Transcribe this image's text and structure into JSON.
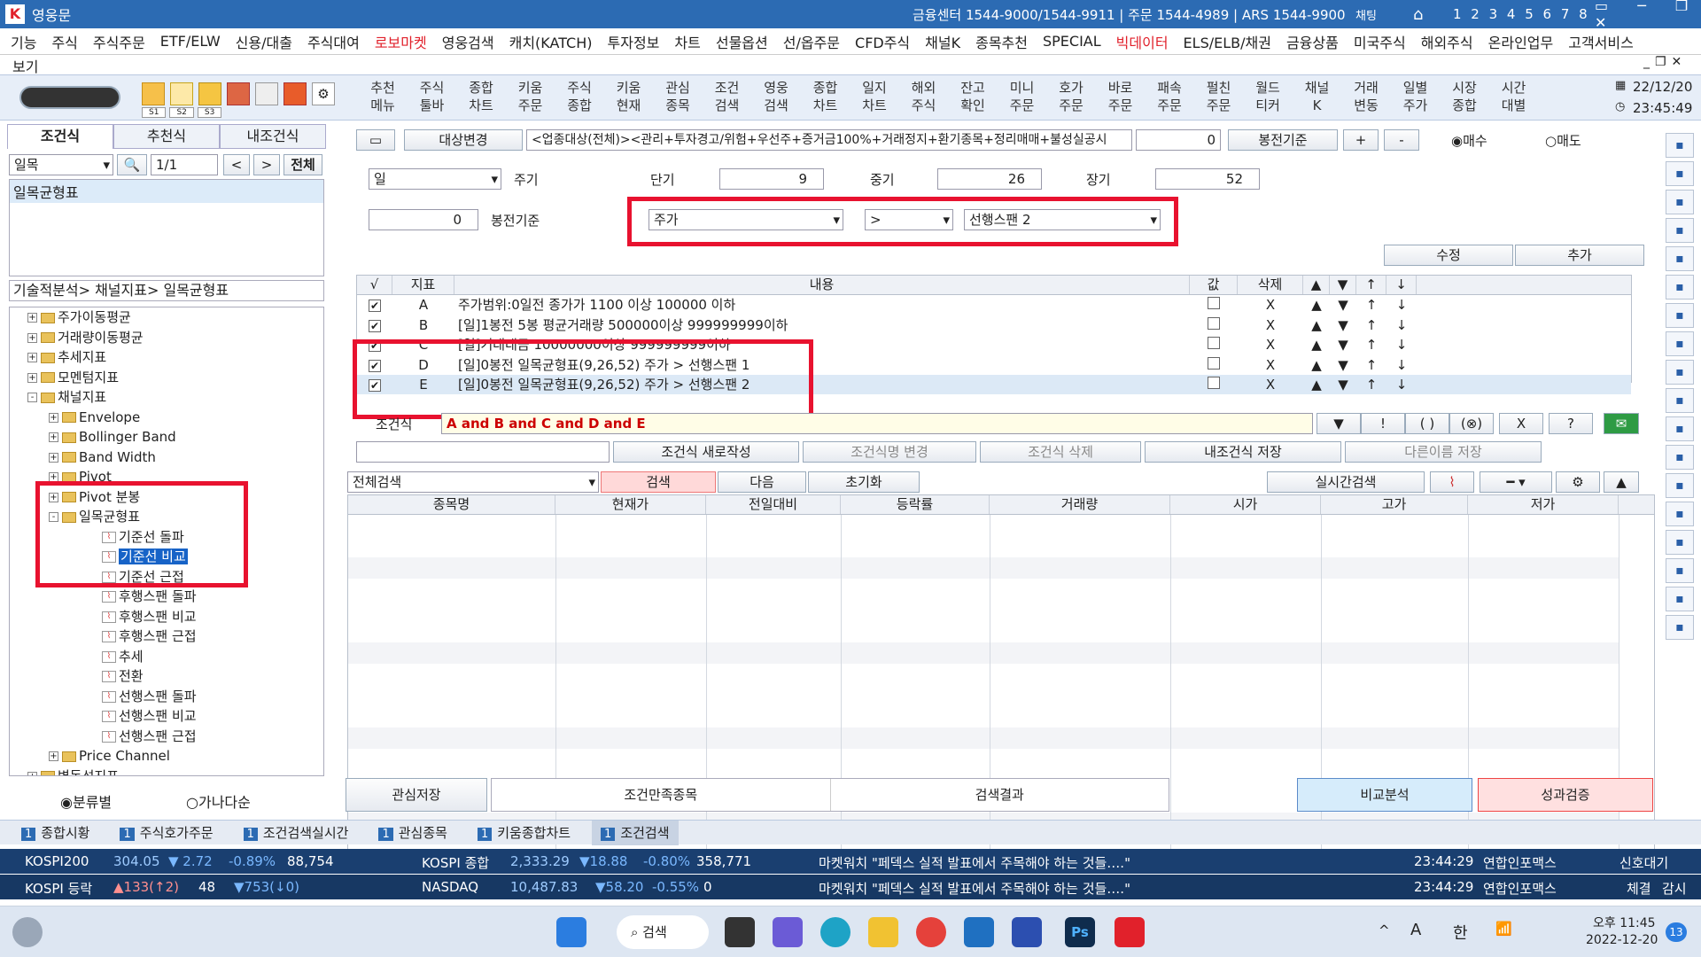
{
  "titlebar": {
    "app": "영웅문",
    "info": "금융센터 1544-9000/1544-9911 | 주문 1544-4989 | ARS 1544-9900",
    "chat": "채팅",
    "nums": "1 2 3 4 5 6 7 8"
  },
  "menu": {
    "items": [
      "기능",
      "주식",
      "주식주문",
      "ETF/ELW",
      "신용/대출",
      "주식대여",
      "로보마켓",
      "영웅검색",
      "캐치(KATCH)",
      "투자정보",
      "차트",
      "선물옵션",
      "선/옵주문",
      "CFD주식",
      "채널K",
      "종목추천",
      "SPECIAL",
      "빅데이터",
      "ELS/ELB/채권",
      "금융상품",
      "미국주식",
      "해외주식",
      "온라인업무",
      "고객서비스"
    ],
    "red_items": [
      "로보마켓",
      "빅데이터"
    ],
    "view": "보기"
  },
  "toolbar": {
    "buttons": [
      "추천 메뉴",
      "주식 툴바",
      "종합 차트",
      "키움 주문",
      "주식 종합",
      "키움 현재",
      "관심 종목",
      "조건 검색",
      "영웅 검색",
      "종합 차트",
      "일지 차트",
      "해외 주식",
      "잔고 확인",
      "미니 주문",
      "호가 주문",
      "바로 주문",
      "패속 주문",
      "펄친 주문",
      "월드 티커",
      "채널 K",
      "거래 변동",
      "일별 주가",
      "시장 종합",
      "시간 대별"
    ],
    "slots": [
      "S1",
      "S2",
      "S3"
    ],
    "date": "22/12/20",
    "time": "23:45:49"
  },
  "left": {
    "tabs": [
      "조건식",
      "추천식",
      "내조건식"
    ],
    "select": "일목",
    "page": "1/1",
    "all_button": "전체",
    "selected_item": "일목균형표",
    "path": "기술적분석> 채널지표> 일목균형표",
    "tree": [
      {
        "label": "주가이동평균",
        "level": 1,
        "type": "folder",
        "pm": "+"
      },
      {
        "label": "거래량이동평균",
        "level": 1,
        "type": "folder",
        "pm": "+"
      },
      {
        "label": "추세지표",
        "level": 1,
        "type": "folder",
        "pm": "+"
      },
      {
        "label": "모멘텀지표",
        "level": 1,
        "type": "folder",
        "pm": "+"
      },
      {
        "label": "채널지표",
        "level": 1,
        "type": "folder",
        "pm": "-"
      },
      {
        "label": "Envelope",
        "level": 2,
        "type": "folder",
        "pm": "+"
      },
      {
        "label": "Bollinger Band",
        "level": 2,
        "type": "folder",
        "pm": "+"
      },
      {
        "label": "Band Width",
        "level": 2,
        "type": "folder",
        "pm": "+"
      },
      {
        "label": "Pivot",
        "level": 2,
        "type": "folder",
        "pm": "+"
      },
      {
        "label": "Pivot 분봉",
        "level": 2,
        "type": "folder",
        "pm": "+"
      },
      {
        "label": "일목균형표",
        "level": 2,
        "type": "folder",
        "pm": "-"
      },
      {
        "label": "기준선 돌파",
        "level": 3,
        "type": "leaf"
      },
      {
        "label": "기준선 비교",
        "level": 3,
        "type": "leaf",
        "selected": true
      },
      {
        "label": "기준선 근접",
        "level": 3,
        "type": "leaf"
      },
      {
        "label": "후행스팬 돌파",
        "level": 3,
        "type": "leaf"
      },
      {
        "label": "후행스팬 비교",
        "level": 3,
        "type": "leaf"
      },
      {
        "label": "후행스팬 근접",
        "level": 3,
        "type": "leaf"
      },
      {
        "label": "추세",
        "level": 3,
        "type": "leaf"
      },
      {
        "label": "전환",
        "level": 3,
        "type": "leaf"
      },
      {
        "label": "선행스팬 돌파",
        "level": 3,
        "type": "leaf"
      },
      {
        "label": "선행스팬 비교",
        "level": 3,
        "type": "leaf"
      },
      {
        "label": "선행스팬 근접",
        "level": 3,
        "type": "leaf"
      },
      {
        "label": "Price Channel",
        "level": 2,
        "type": "folder",
        "pm": "+"
      },
      {
        "label": "변동성지표",
        "level": 1,
        "type": "folder",
        "pm": "+"
      }
    ],
    "radio1": "분류별",
    "radio2": "가나다순"
  },
  "target": {
    "button": "대상변경",
    "text": "<업종대상(전체)><관리+투자경고/위험+우선주+증거금100%+거래정지+환기종목+정리매매+불성실공시",
    "value": "0",
    "bong": "봉전기준",
    "plus": "+",
    "minus": "-",
    "buy": "매수",
    "sell": "매도"
  },
  "params": {
    "period": "일",
    "period_label": "주기",
    "short_label": "단기",
    "short": "9",
    "mid_label": "중기",
    "mid": "26",
    "long_label": "장기",
    "long": "52",
    "bong_value": "0",
    "bong_label": "봉전기준",
    "sel1": "주가",
    "sel2": ">",
    "sel3": "선행스팬 2",
    "edit": "수정",
    "add": "추가"
  },
  "cond_table": {
    "headers": [
      "√",
      "지표",
      "내용",
      "값",
      "삭제",
      "▲",
      "▼",
      "↑",
      "↓"
    ],
    "rows": [
      {
        "id": "A",
        "text": "주가범위:0일전 종가가 1100 이상 100000 이하"
      },
      {
        "id": "B",
        "text": "[일]1봉전 5봉 평균거래량 500000이상 999999999이하"
      },
      {
        "id": "C",
        "text": "[일]거래대금 10000000이상 999999999이하"
      },
      {
        "id": "D",
        "text": "[일]0봉전 일목균형표(9,26,52) 주가 > 선행스팬 1"
      },
      {
        "id": "E",
        "text": "[일]0봉전 일목균형표(9,26,52) 주가 > 선행스팬 2"
      }
    ],
    "x": "X",
    "up": "▲",
    "down": "▼",
    "top": "↑",
    "bottom": "↓",
    "check": "✔"
  },
  "formula": {
    "label": "조건식",
    "text": "A and B and C and D and E",
    "btns": [
      "▼",
      "!",
      "( )",
      "(⊗)",
      "X",
      "?"
    ]
  },
  "actions": [
    "조건식 새로작성",
    "조건식명 변경",
    "조건식 삭제",
    "내조건식 저장",
    "다른이름 저장"
  ],
  "search": {
    "scope": "전체검색",
    "search": "검색",
    "next": "다음",
    "reset": "초기화",
    "realtime": "실시간검색"
  },
  "result_cols": [
    "종목명",
    "현재가",
    "전일대비",
    "등락률",
    "거래량",
    "시가",
    "고가",
    "저가"
  ],
  "bottom": {
    "save": "관심저장",
    "tab1": "조건만족종목",
    "tab2": "검색결과",
    "compare": "비교분석",
    "verify": "성과검증"
  },
  "status_tabs": [
    {
      "n": "1",
      "label": "종합시황"
    },
    {
      "n": "1",
      "label": "주식호가주문"
    },
    {
      "n": "1",
      "label": "조건검색실시간"
    },
    {
      "n": "1",
      "label": "관심종목"
    },
    {
      "n": "1",
      "label": "키움종합차트"
    },
    {
      "n": "1",
      "label": "조건검색"
    }
  ],
  "ticker1": {
    "name": "KOSPI200",
    "v1": "304.05",
    "v2": "▼ 2.72",
    "v3": "-0.89%",
    "v4": "88,754",
    "name2": "KOSPI 종합",
    "w1": "2,333.29",
    "w2": "▼18.88",
    "w3": "-0.80%",
    "w4": "358,771",
    "news": "마켓워치 \"페덱스 실적 발표에서 주목해야 하는 것들….\"",
    "time": "23:44:29",
    "src": "연합인포맥스",
    "tail": "신호대기"
  },
  "ticker2": {
    "name": "KOSPI 등락",
    "v1": "▲133(↑2)",
    "v2": "48",
    "v3": "▼753(↓0)",
    "name2": "NASDAQ",
    "w1": "10,487.83",
    "w2": "▼58.20",
    "w3": "-0.55%",
    "w4": "0",
    "news": "마켓워치 \"페덱스 실적 발표에서 주목해야 하는 것들….\"",
    "time": "23:44:29",
    "src": "연합인포맥스",
    "tail1": "체결",
    "tail2": "감시"
  },
  "taskbar": {
    "search": "검색",
    "ampm": "오후 11:45",
    "date": "2022-12-20",
    "badge": "13",
    "lang": "한",
    "a": "A"
  }
}
